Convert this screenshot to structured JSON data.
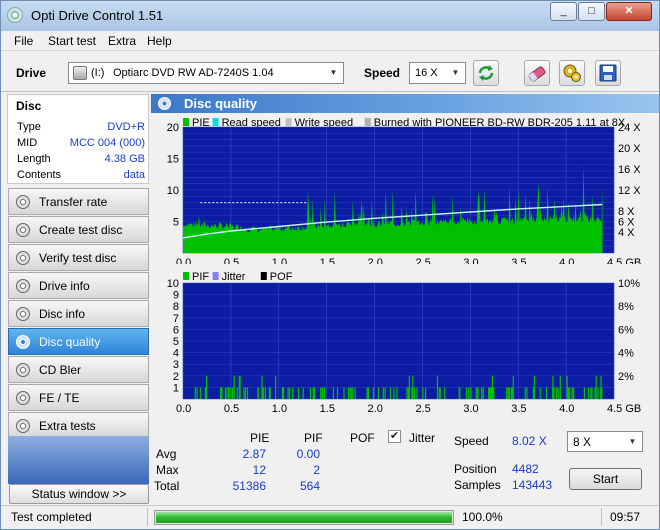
{
  "window": {
    "title": "Opti Drive Control 1.51",
    "min_icon": "_",
    "max_icon": "□",
    "close_icon": "✕"
  },
  "menu": [
    "File",
    "Start test",
    "Extra",
    "Help"
  ],
  "toolbar": {
    "drive_label": "Drive",
    "drive_letter": "(I:)",
    "drive_value": "Optiarc DVD RW AD-7240S 1.04",
    "speed_label": "Speed",
    "speed_value": "16 X",
    "icons": [
      "refresh-icon",
      "erase-icon",
      "settings-icon",
      "save-icon"
    ]
  },
  "disc": {
    "heading": "Disc",
    "rows": [
      {
        "key": "Type",
        "value": "DVD+R"
      },
      {
        "key": "MID",
        "value": "MCC 004 (000)"
      },
      {
        "key": "Length",
        "value": "4.38 GB"
      },
      {
        "key": "Contents",
        "value": "data"
      }
    ]
  },
  "nav": [
    {
      "label": "Transfer rate",
      "active": false
    },
    {
      "label": "Create test disc",
      "active": false
    },
    {
      "label": "Verify test disc",
      "active": false
    },
    {
      "label": "Drive info",
      "active": false
    },
    {
      "label": "Disc info",
      "active": false
    },
    {
      "label": "Disc quality",
      "active": true
    },
    {
      "label": "CD Bler",
      "active": false
    },
    {
      "label": "FE / TE",
      "active": false
    },
    {
      "label": "Extra tests",
      "active": false
    }
  ],
  "status_window_button": "Status window >>",
  "panel": {
    "title": "Disc quality"
  },
  "chart_data": [
    {
      "type": "area",
      "legend": [
        {
          "label": "PIE",
          "color": "#00c000"
        },
        {
          "label": "Read speed",
          "color": "#00e0e0"
        },
        {
          "label": "Write speed",
          "color": "#c0c0c0"
        },
        {
          "label": "Burned with PIONEER BD-RW   BDR-205 1.11 at 8X",
          "color": "#b0b0b0"
        }
      ],
      "x_ticks": [
        "0.0",
        "0.5",
        "1.0",
        "1.5",
        "2.0",
        "2.5",
        "3.0",
        "3.5",
        "4.0",
        "4.5 GB"
      ],
      "y_ticks_left": [
        "5",
        "10",
        "15",
        "20"
      ],
      "y_ticks_right": [
        "4 X",
        "6 X",
        "8 X",
        "12 X",
        "16 X",
        "20 X",
        "24 X"
      ],
      "xlim": [
        0,
        4.5
      ],
      "ylim": [
        0,
        20
      ],
      "pie_base": [
        [
          0,
          4.6
        ],
        [
          0.5,
          4.2
        ],
        [
          0.8,
          3.7
        ],
        [
          1.2,
          4.0
        ],
        [
          1.5,
          4.4
        ],
        [
          2.0,
          4.6
        ],
        [
          2.5,
          4.8
        ],
        [
          3.0,
          5.0
        ],
        [
          3.5,
          5.2
        ],
        [
          4.0,
          5.4
        ],
        [
          4.38,
          5.4
        ]
      ],
      "read_speed": [
        [
          0,
          2.4
        ],
        [
          0.25,
          3.0
        ],
        [
          0.5,
          3.5
        ],
        [
          1.0,
          4.2
        ],
        [
          1.5,
          4.9
        ],
        [
          2.0,
          5.5
        ],
        [
          2.5,
          6.0
        ],
        [
          3.0,
          6.5
        ],
        [
          3.5,
          7.0
        ],
        [
          4.0,
          7.4
        ],
        [
          4.38,
          7.7
        ]
      ],
      "write_speed": [
        [
          0.18,
          8.0
        ],
        [
          1.3,
          8.0
        ]
      ],
      "burned_with": "PIONEER BD-RW   BDR-205 1.11 at 8X"
    },
    {
      "type": "bar",
      "legend": [
        {
          "label": "PIF",
          "color": "#00c000"
        },
        {
          "label": "Jitter",
          "color": "#8080ff"
        },
        {
          "label": "POF",
          "color": "#000000"
        }
      ],
      "x_ticks": [
        "0.0",
        "0.5",
        "1.0",
        "1.5",
        "2.0",
        "2.5",
        "3.0",
        "3.5",
        "4.0",
        "4.5 GB"
      ],
      "y_ticks_left": [
        "1",
        "2",
        "3",
        "4",
        "5",
        "6",
        "7",
        "8",
        "9",
        "10"
      ],
      "y_ticks_right": [
        "2%",
        "4%",
        "6%",
        "8%",
        "10%"
      ],
      "xlim": [
        0,
        4.5
      ],
      "ylim": [
        0,
        10
      ]
    }
  ],
  "stats": {
    "headers": {
      "pie": "PIE",
      "pif": "PIF",
      "pof": "POF",
      "jitter": "Jitter"
    },
    "avg": {
      "label": "Avg",
      "pie": "2.87",
      "pif": "0.00"
    },
    "max": {
      "label": "Max",
      "pie": "12",
      "pif": "2"
    },
    "total": {
      "label": "Total",
      "pie": "51386",
      "pif": "564"
    },
    "jitter_checked": true,
    "speed_label": "Speed",
    "speed_value": "8.02 X",
    "run_speed": "8 X",
    "position_label": "Position",
    "position_value": "4482",
    "samples_label": "Samples",
    "samples_value": "143443",
    "start_label": "Start"
  },
  "statusbar": {
    "text": "Test completed",
    "progress": 1.0,
    "percent": "100.0%",
    "time": "09:57"
  }
}
